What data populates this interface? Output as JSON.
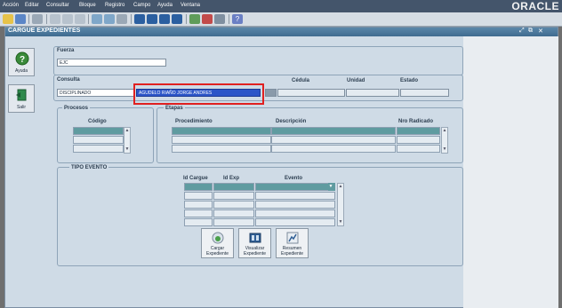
{
  "menu": [
    "Acción",
    "Editar",
    "Consultar",
    "Bloque",
    "Registro",
    "Campo",
    "Ayuda",
    "Ventana"
  ],
  "brand": "ORACLE",
  "window": {
    "title": "CARGUE EXPEDIENTES",
    "controls": [
      "⤢",
      "⧉",
      "✕"
    ]
  },
  "sidebar": {
    "ayuda": "Ayuda",
    "salir": "Salir"
  },
  "fuerza": {
    "label": "Fuerza",
    "value": "EJC"
  },
  "consulta": {
    "label": "Consulta",
    "tipo": "DISCIPLINADO",
    "nombre": "AGUDELO RIAÑO JORGE ANDRES",
    "cedula_label": "Cédula",
    "unidad_label": "Unidad",
    "estado_label": "Estado"
  },
  "procesos": {
    "label": "Procesos",
    "codigo_header": "Código"
  },
  "etapas": {
    "label": "Etapas",
    "procedimiento_header": "Procedimiento",
    "descripcion_header": "Descripción",
    "radicado_header": "Nro Radicado"
  },
  "tipo_evento": {
    "label": "TIPO EVENTO",
    "id_cargue_header": "Id Cargue",
    "id_exp_header": "Id Exp",
    "evento_header": "Evento"
  },
  "actions": {
    "cargar": [
      "Cargar",
      "Expediente"
    ],
    "visualizar": [
      "Visualizar",
      "Expediente"
    ],
    "resumen": [
      "Resumen",
      "Expediente"
    ]
  },
  "colors": {
    "menubar": "#44556b",
    "titlebar": "#3f6b8f",
    "highlight": "#2c55c8",
    "selected_row": "#5f9ba0",
    "focus_box": "#e02020"
  }
}
